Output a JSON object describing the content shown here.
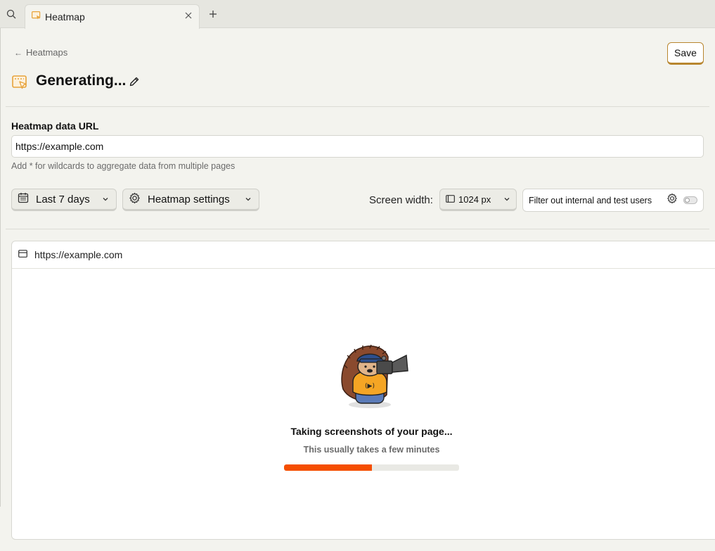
{
  "tabbar": {
    "tabs": [
      {
        "label": "Heatmap",
        "icon": "heatmap-icon",
        "active": true
      }
    ],
    "search_icon": "search-icon",
    "add_icon": "plus-icon",
    "close_icon": "close-icon"
  },
  "header": {
    "back_label": "Heatmaps",
    "title": "Generating...",
    "save_label": "Save"
  },
  "url_field": {
    "label": "Heatmap data URL",
    "value": "https://example.com",
    "hint": "Add * for wildcards to aggregate data from multiple pages"
  },
  "controls": {
    "date_range": "Last 7 days",
    "settings": "Heatmap settings",
    "screen_width_label": "Screen width:",
    "screen_width_value": "1024 px",
    "filter_label": "Filter out internal and test users",
    "filter_enabled": false
  },
  "preview": {
    "url": "https://example.com",
    "loading_title": "Taking screenshots of your page...",
    "loading_subtitle": "This usually takes a few minutes",
    "progress": 0.5
  },
  "colors": {
    "accent": "#f54e00",
    "save_border": "#b8862f",
    "icon_orange": "#e7a33b",
    "background": "#f3f3ee"
  }
}
